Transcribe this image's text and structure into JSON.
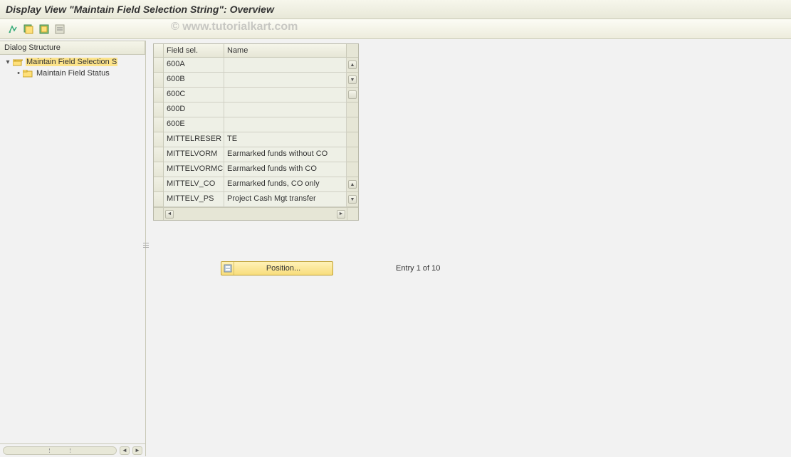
{
  "header": {
    "title": "Display View \"Maintain Field Selection String\": Overview"
  },
  "watermark": "© www.tutorialkart.com",
  "toolbar": {
    "buttons": [
      "expand",
      "select-all",
      "deselect-all",
      "table-view"
    ]
  },
  "sidebar": {
    "title": "Dialog Structure",
    "items": [
      {
        "label": "Maintain Field Selection S",
        "level": 1,
        "selected": true,
        "expanded": true,
        "folder": "open"
      },
      {
        "label": "Maintain Field Status",
        "level": 2,
        "selected": false,
        "expanded": false,
        "folder": "closed"
      }
    ]
  },
  "table": {
    "headers": {
      "field_sel": "Field sel.",
      "name": "Name"
    },
    "rows": [
      {
        "field": "600A",
        "name": ""
      },
      {
        "field": "600B",
        "name": ""
      },
      {
        "field": "600C",
        "name": ""
      },
      {
        "field": "600D",
        "name": ""
      },
      {
        "field": "600E",
        "name": ""
      },
      {
        "field": "MITTELRESER",
        "name": "TE"
      },
      {
        "field": "MITTELVORM",
        "name": "Earmarked funds without CO"
      },
      {
        "field": "MITTELVORMC",
        "name": "Earmarked funds with CO"
      },
      {
        "field": "MITTELV_CO",
        "name": "Earmarked funds, CO only"
      },
      {
        "field": "MITTELV_PS",
        "name": "Project Cash Mgt transfer"
      }
    ]
  },
  "position": {
    "button_label": "Position...",
    "entry_text": "Entry 1 of 10"
  }
}
